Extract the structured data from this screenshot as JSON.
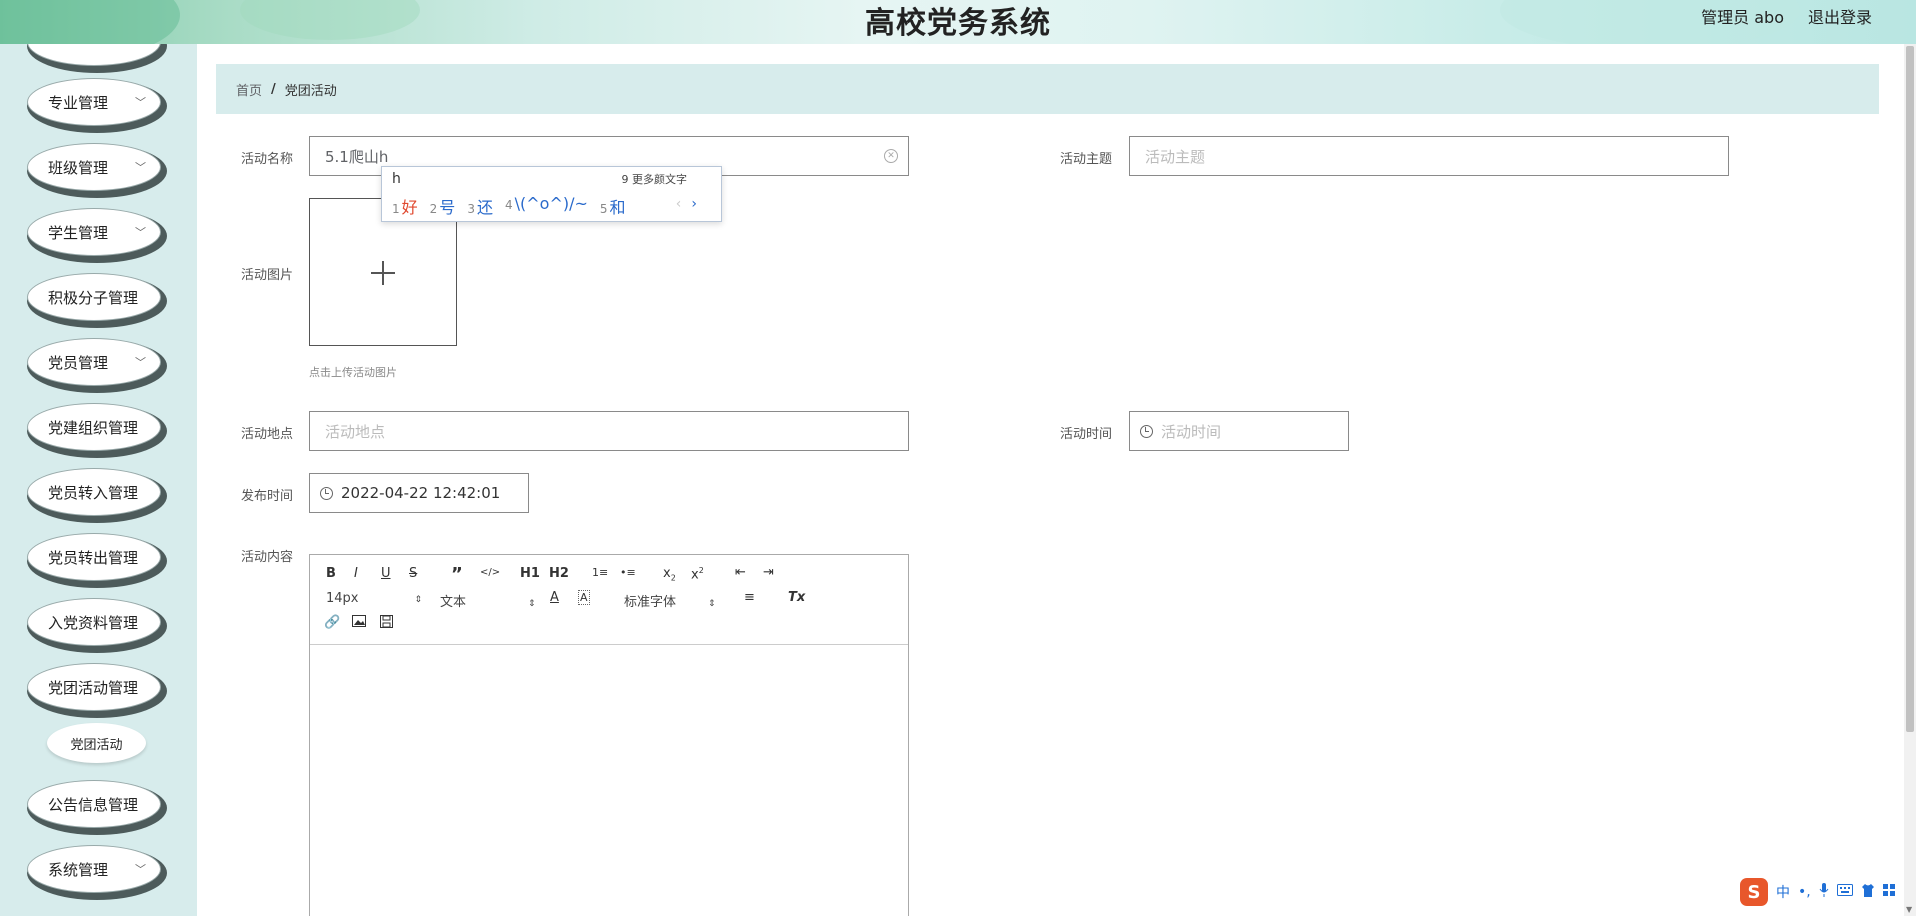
{
  "header": {
    "title": "高校党务系统",
    "user": "管理员 abo",
    "logout": "退出登录"
  },
  "sidebar": {
    "items": [
      {
        "label": "专业管理",
        "chevron": true
      },
      {
        "label": "班级管理",
        "chevron": true
      },
      {
        "label": "学生管理",
        "chevron": true
      },
      {
        "label": "积极分子管理",
        "chevron": false
      },
      {
        "label": "党员管理",
        "chevron": true
      },
      {
        "label": "党建组织管理",
        "chevron": false
      },
      {
        "label": "党员转入管理",
        "chevron": false
      },
      {
        "label": "党员转出管理",
        "chevron": false
      },
      {
        "label": "入党资料管理",
        "chevron": false
      },
      {
        "label": "党团活动管理",
        "chevron": false
      },
      {
        "label": "公告信息管理",
        "chevron": false
      },
      {
        "label": "系统管理",
        "chevron": true
      }
    ],
    "sub_item": "党团活动"
  },
  "breadcrumb": {
    "home": "首页",
    "separator": "/",
    "current": "党团活动"
  },
  "form": {
    "name_label": "活动名称",
    "name_value": "5.1爬山h",
    "theme_label": "活动主题",
    "theme_placeholder": "活动主题",
    "image_label": "活动图片",
    "image_tip": "点击上传活动图片",
    "place_label": "活动地点",
    "place_placeholder": "活动地点",
    "time_label": "活动时间",
    "time_placeholder": "活动时间",
    "publish_label": "发布时间",
    "publish_value": "2022-04-22 12:42:01",
    "content_label": "活动内容"
  },
  "editor": {
    "font_size": "14px",
    "header_select": "文本",
    "font_family": "标准字体",
    "buttons": [
      "B",
      "I",
      "U",
      "S",
      "”",
      "</>",
      "H1",
      "H2",
      "1≡",
      "•≡",
      "x2",
      "x2",
      "⇤",
      "⇥",
      "A",
      "A",
      "≡",
      "Tx"
    ]
  },
  "ime": {
    "composition": "h",
    "more_num": "9",
    "more_label": "更多颜文字",
    "candidates": [
      {
        "num": "1",
        "text": "好"
      },
      {
        "num": "2",
        "text": "号"
      },
      {
        "num": "3",
        "text": "还"
      },
      {
        "num": "4",
        "text": "\\(^o^)/~"
      },
      {
        "num": "5",
        "text": "和"
      }
    ],
    "prev": "‹",
    "next": "›"
  },
  "imebar": {
    "logo": "S",
    "mode": "中",
    "punct": "•,"
  }
}
